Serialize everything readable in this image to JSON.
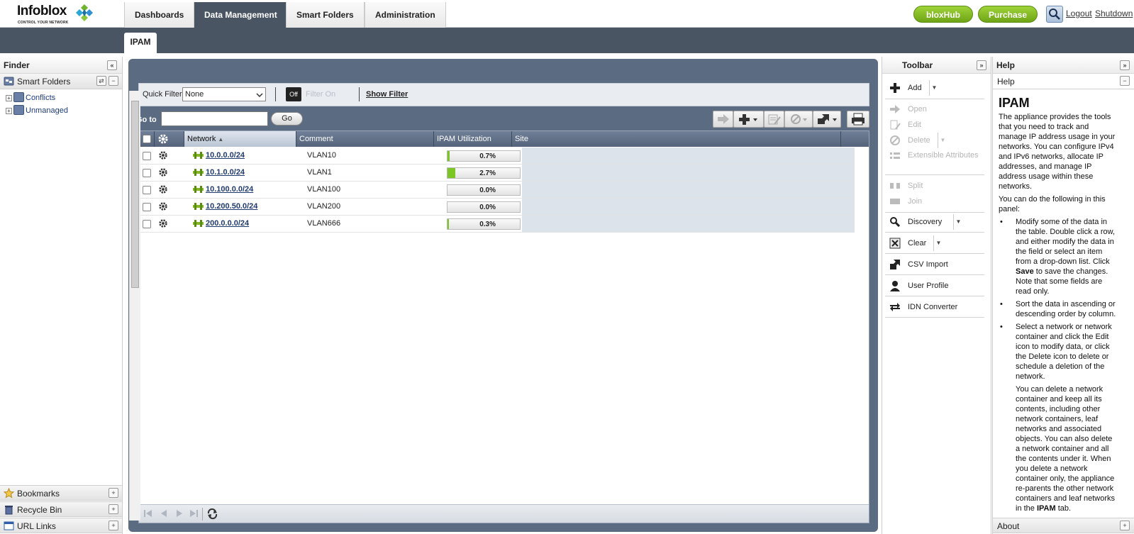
{
  "brand": {
    "name": "Infoblox",
    "tagline": "CONTROL YOUR NETWORK"
  },
  "nav": {
    "tabs": [
      "Dashboards",
      "Data Management",
      "Smart Folders",
      "Administration"
    ],
    "active": "Data Management"
  },
  "topright": {
    "bloxhub": "bloxHub",
    "purchase": "Purchase",
    "logout": "Logout",
    "shutdown": "Shutdown"
  },
  "subtab": "IPAM",
  "finder": {
    "title": "Finder",
    "smart_folders": "Smart Folders",
    "tree": [
      "Conflicts",
      "Unmanaged"
    ],
    "bookmarks": "Bookmarks",
    "recycle_bin": "Recycle Bin",
    "url_links": "URL Links"
  },
  "filter": {
    "label": "Quick Filter",
    "value": "None",
    "toggle": "Off",
    "status": "Filter On",
    "show": "Show Filter"
  },
  "goto": {
    "label": "Go to",
    "button": "Go",
    "value": ""
  },
  "grid": {
    "columns": [
      "Network",
      "Comment",
      "IPAM Utilization",
      "Site"
    ],
    "rows": [
      {
        "network": "10.0.0.0/24",
        "comment": "VLAN10",
        "util": "0.7%",
        "util_frac": 0.007
      },
      {
        "network": "10.1.0.0/24",
        "comment": "VLAN1",
        "util": "2.7%",
        "util_frac": 0.027
      },
      {
        "network": "10.100.0.0/24",
        "comment": "VLAN100",
        "util": "0.0%",
        "util_frac": 0.0
      },
      {
        "network": "10.200.50.0/24",
        "comment": "VLAN200",
        "util": "0.0%",
        "util_frac": 0.0
      },
      {
        "network": "200.0.0.0/24",
        "comment": "VLAN666",
        "util": "0.3%",
        "util_frac": 0.003
      }
    ]
  },
  "toolbar": {
    "title": "Toolbar",
    "items": [
      "Add",
      "Open",
      "Edit",
      "Delete",
      "Extensible Attributes",
      "Split",
      "Join",
      "Discovery",
      "Clear",
      "CSV Import",
      "User Profile",
      "IDN Converter"
    ]
  },
  "help": {
    "title": "Help",
    "sub": "Help",
    "heading": "IPAM",
    "intro": "The appliance provides the tools that you need to track and manage IP address usage in your networks. You can configure IPv4 and IPv6 networks, allocate IP addresses, and manage IP address usage within these networks.",
    "lead": "You can do the following in this panel:",
    "b1a": "Modify some of the data in the table. Double click a row, and either modify the data in the field or select an item from a drop-down list. Click ",
    "b1b": "Save",
    "b1c": " to save the changes. Note that some fields are read only.",
    "b2": "Sort the data in ascending or descending order by column.",
    "b3": "Select a network or network container and click the Edit icon to modify data, or click the Delete icon to delete or schedule a deletion of the network.",
    "b3p_a": "You can delete a network container and keep all its contents, including other network containers, leaf networks and associated objects. You can also delete a network container and all the contents under it. When you delete a network container only, the appliance re-parents the other network containers and leaf networks in the ",
    "b3p_b": "IPAM",
    "b3p_c": " tab.",
    "about": "About"
  },
  "colors": {
    "nav_dark": "#4a5563",
    "main_panel": "#5b6b82",
    "green_button": "#7fb820",
    "util_fill": "#7bc623"
  }
}
